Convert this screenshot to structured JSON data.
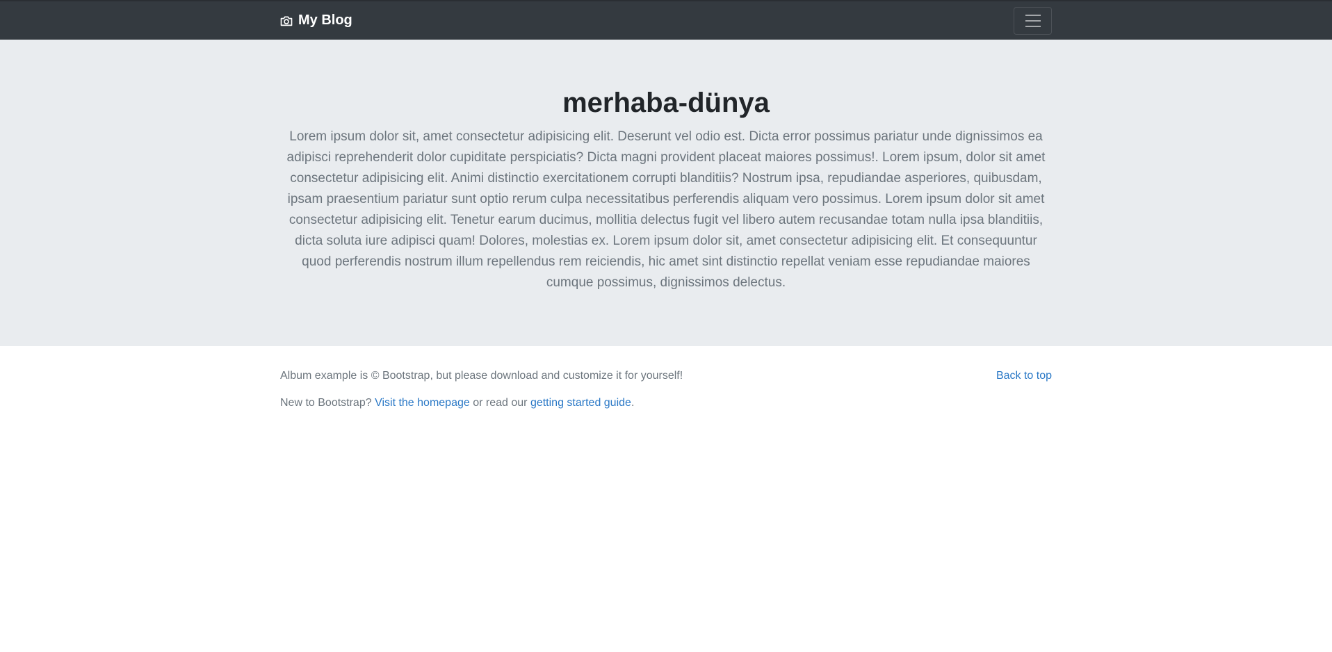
{
  "navbar": {
    "brand_icon": "camera-icon",
    "brand_label": "My Blog",
    "toggler_icon": "hamburger-menu-icon"
  },
  "hero": {
    "title": "merhaba-dünya",
    "lead": "Lorem ipsum dolor sit, amet consectetur adipisicing elit. Deserunt vel odio est. Dicta error possimus pariatur unde dignissimos ea adipisci reprehenderit dolor cupiditate perspiciatis? Dicta magni provident placeat maiores possimus!. Lorem ipsum, dolor sit amet consectetur adipisicing elit. Animi distinctio exercitationem corrupti blanditiis? Nostrum ipsa, repudiandae asperiores, quibusdam, ipsam praesentium pariatur sunt optio rerum culpa necessitatibus perferendis aliquam vero possimus. Lorem ipsum dolor sit amet consectetur adipisicing elit. Tenetur earum ducimus, mollitia delectus fugit vel libero autem recusandae totam nulla ipsa blanditiis, dicta soluta iure adipisci quam! Dolores, molestias ex. Lorem ipsum dolor sit, amet consectetur adipisicing elit. Et consequuntur quod perferendis nostrum illum repellendus rem reiciendis, hic amet sint distinctio repellat veniam esse repudiandae maiores cumque possimus, dignissimos delectus."
  },
  "footer": {
    "copyright_text": "Album example is © Bootstrap, but please download and customize it for yourself!",
    "back_to_top": "Back to top",
    "new_prefix": "New to Bootstrap?",
    "homepage_link": "Visit the homepage",
    "middle_text": "or read our",
    "guide_link": "getting started guide",
    "period": "."
  },
  "colors": {
    "navbar_bg": "#343a40",
    "hero_bg": "#e9ecef",
    "link": "#2a78c6",
    "muted_text": "#6c757d"
  }
}
